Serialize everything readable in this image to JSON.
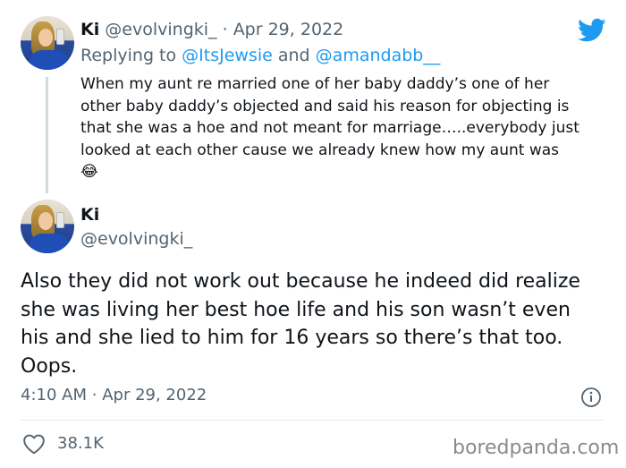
{
  "colors": {
    "twitter_blue": "#1d9bf0",
    "text": "#0f1419",
    "muted": "#536471",
    "divider": "#e1e8ed"
  },
  "reply_tweet": {
    "display_name": "Ki",
    "handle": "@evolvingki_",
    "separator": "·",
    "date": "Apr 29, 2022",
    "replying_prefix": "Replying to",
    "reply_to_1": "@ItsJewsie",
    "reply_and": "and",
    "reply_to_2": "@amandabb__",
    "text": "When my aunt re married one of her baby daddy’s one of her other baby daddy’s objected and said his reason for objecting is that she was a hoe and not meant for marriage…..everybody just looked at each other cause we already knew how my aunt was 😂",
    "avatar_icon": "profile-photo"
  },
  "main_tweet": {
    "display_name": "Ki",
    "handle": "@evolvingki_",
    "text": "Also they did not work out because he indeed did realize she was living her best hoe life and his son wasn’t even his and she lied to him for 16 years so there’s that too. Oops.",
    "time": "4:10 AM",
    "separator": "·",
    "date": "Apr 29, 2022",
    "likes": "38.1K",
    "info_icon": "info-icon",
    "like_icon": "heart-icon"
  },
  "brand": {
    "logo_icon": "twitter-bird-icon",
    "watermark": "boredpanda.com"
  }
}
